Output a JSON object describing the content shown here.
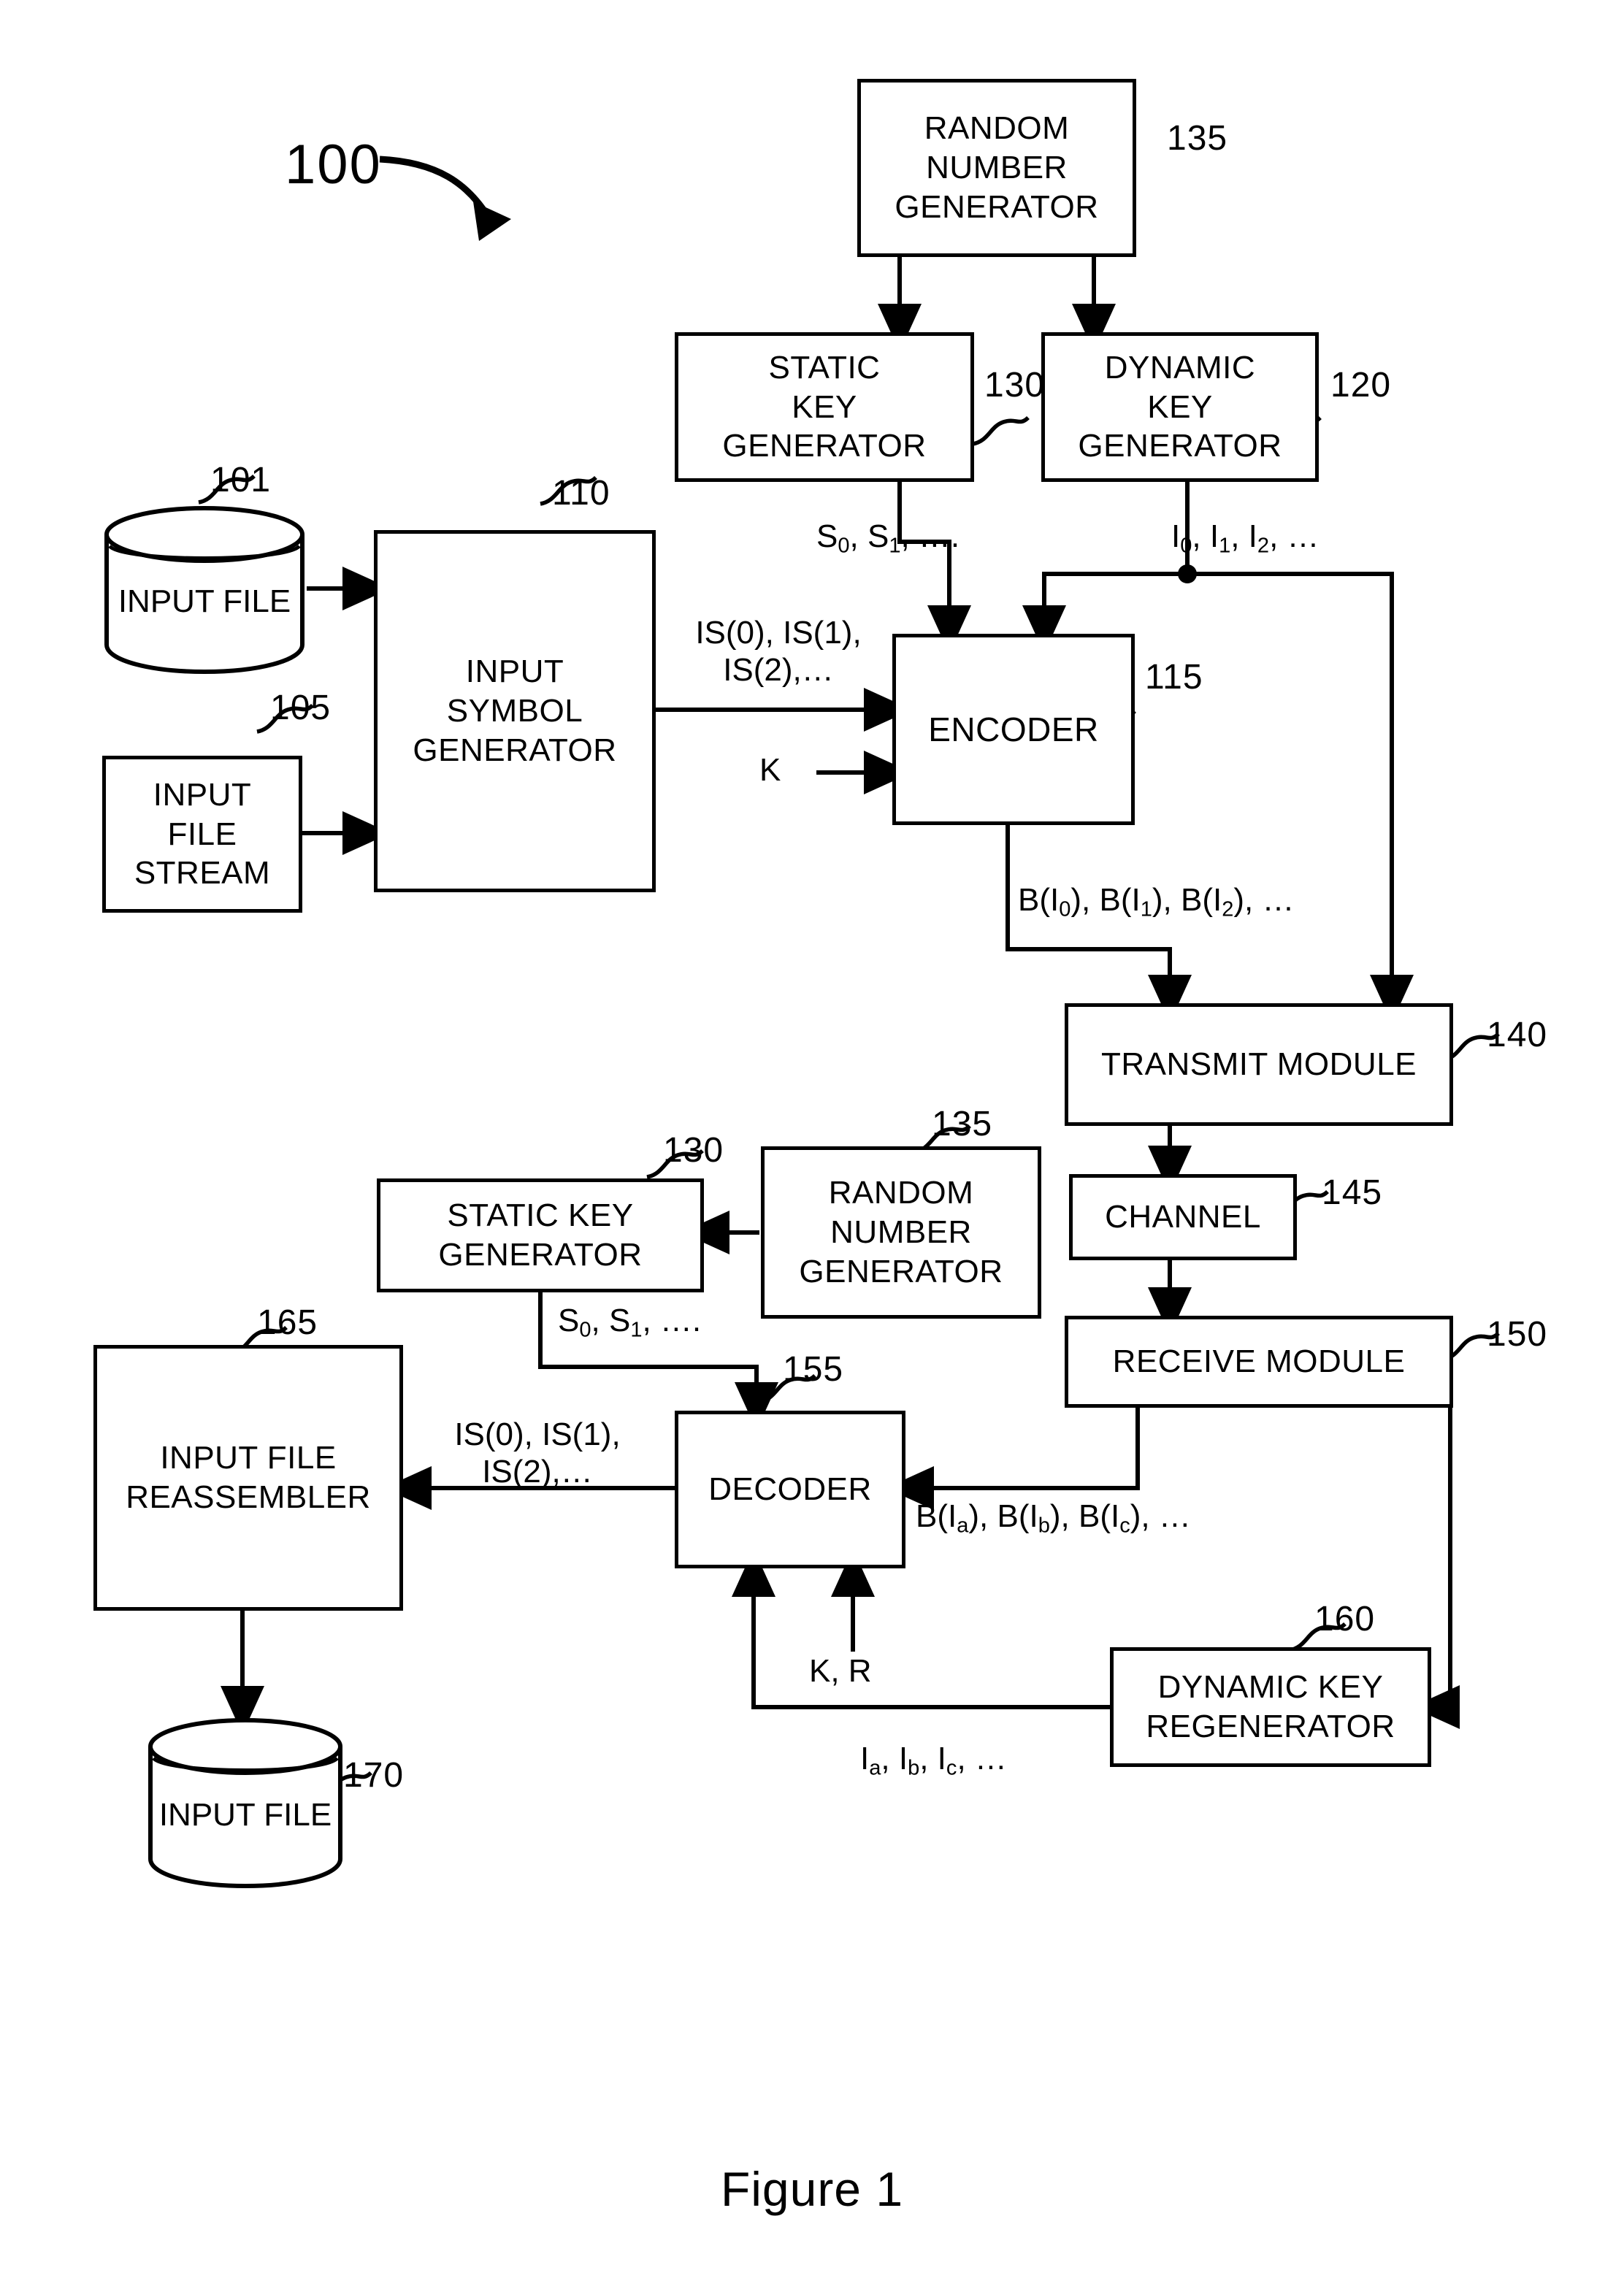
{
  "figure": {
    "caption": "Figure 1",
    "system_ref": "100"
  },
  "blocks": [
    {
      "id": "random-number-generator-top",
      "ref": "135",
      "lines": [
        "RANDOM",
        "NUMBER",
        "GENERATOR"
      ]
    },
    {
      "id": "static-key-generator-top",
      "ref": "130",
      "lines": [
        "STATIC",
        "KEY",
        "GENERATOR"
      ]
    },
    {
      "id": "dynamic-key-generator",
      "ref": "120",
      "lines": [
        "DYNAMIC",
        "KEY",
        "GENERATOR"
      ]
    },
    {
      "id": "input-file-source",
      "ref": "101",
      "lines": [
        "INPUT",
        "FILE"
      ]
    },
    {
      "id": "input-file-stream",
      "ref": "105",
      "lines": [
        "INPUT",
        "FILE",
        "STREAM"
      ]
    },
    {
      "id": "input-symbol-generator",
      "ref": "110",
      "lines": [
        "INPUT",
        "SYMBOL",
        "GENERATOR"
      ]
    },
    {
      "id": "encoder",
      "ref": "115",
      "lines": [
        "ENCODER"
      ]
    },
    {
      "id": "transmit-module",
      "ref": "140",
      "lines": [
        "TRANSMIT MODULE"
      ]
    },
    {
      "id": "channel",
      "ref": "145",
      "lines": [
        "CHANNEL"
      ]
    },
    {
      "id": "receive-module",
      "ref": "150",
      "lines": [
        "RECEIVE MODULE"
      ]
    },
    {
      "id": "random-number-generator-bottom",
      "ref": "135",
      "lines": [
        "RANDOM",
        "NUMBER",
        "GENERATOR"
      ]
    },
    {
      "id": "static-key-generator-bottom",
      "ref": "130",
      "lines": [
        "STATIC KEY",
        "GENERATOR"
      ]
    },
    {
      "id": "decoder",
      "ref": "155",
      "lines": [
        "DECODER"
      ]
    },
    {
      "id": "dynamic-key-regenerator",
      "ref": "160",
      "lines": [
        "DYNAMIC KEY",
        "REGENERATOR"
      ]
    },
    {
      "id": "input-file-reassembler",
      "ref": "165",
      "lines": [
        "INPUT FILE",
        "REASSEMBLER"
      ]
    },
    {
      "id": "input-file-output",
      "ref": "170",
      "lines": [
        "INPUT",
        "FILE"
      ]
    }
  ],
  "signals": {
    "static_keys_top": "S<sub>0</sub>, S<sub>1</sub>, ….",
    "dynamic_keys": "I<sub>0</sub>,  I<sub>1</sub>,  I<sub>2</sub>,  …",
    "input_symbols_encoder_l1": "IS(0), IS(1),",
    "input_symbols_encoder_l2": "IS(2),…",
    "encoder_k": "K",
    "encoded_blocks": "B(I<sub>0</sub>), B(I<sub>1</sub>), B(I<sub>2</sub>), …",
    "static_keys_bottom": "S<sub>0</sub>, S<sub>1</sub>, ….",
    "input_symbols_decoder_l1": "IS(0), IS(1),",
    "input_symbols_decoder_l2": "IS(2),…",
    "received_blocks": "B(I<sub>a</sub>), B(I<sub>b</sub>), B(I<sub>c</sub>), …",
    "decoder_kr": "K, R",
    "regenerated_keys": "I<sub>a</sub>,  I<sub>b</sub>,  I<sub>c</sub>,  …"
  },
  "colors": {
    "line": "#000000",
    "background": "#ffffff"
  }
}
